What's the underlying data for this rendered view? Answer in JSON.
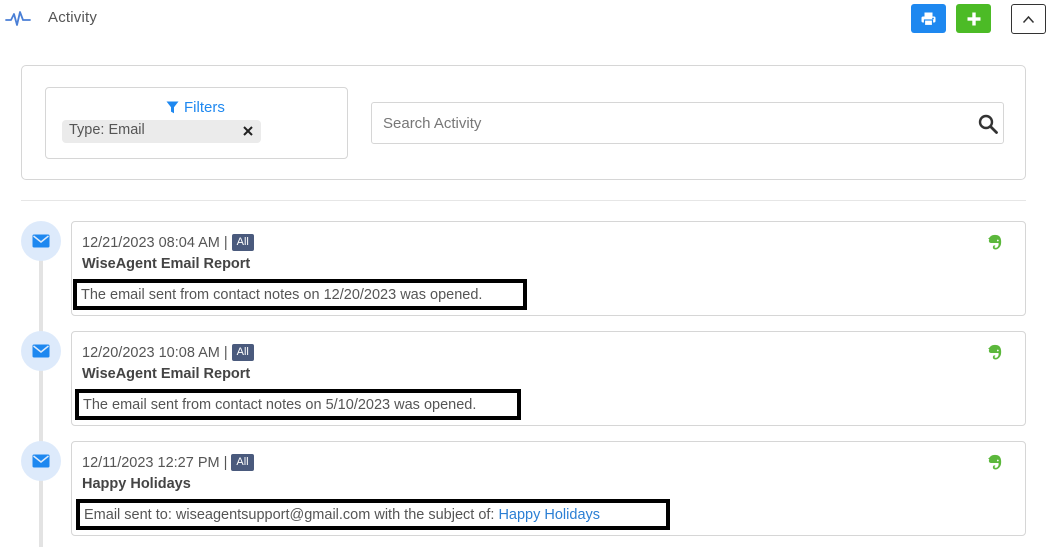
{
  "header": {
    "title": "Activity",
    "activity_icon": "pulse-icon",
    "print_icon": "printer-icon",
    "add_icon": "plus-icon",
    "collapse_icon": "chevron-up-icon"
  },
  "filters": {
    "label": "Filters",
    "icon": "funnel-icon",
    "chip_label": "Type: Email",
    "chip_close_icon": "close-icon"
  },
  "search": {
    "placeholder": "Search Activity",
    "icon": "search-icon"
  },
  "entries": [
    {
      "datetime": "12/21/2023 08:04 AM",
      "separator": "|",
      "badge": "All",
      "title": "WiseAgent Email Report",
      "body": "The email sent from contact notes on 12/20/2023 was opened.",
      "icon": "envelope-icon",
      "action_icon": "evernote-icon"
    },
    {
      "datetime": "12/20/2023 10:08 AM",
      "separator": "|",
      "badge": "All",
      "title": "WiseAgent Email Report",
      "body": "The email sent from contact notes on 5/10/2023 was opened.",
      "icon": "envelope-icon",
      "action_icon": "evernote-icon"
    },
    {
      "datetime": "12/11/2023 12:27 PM",
      "separator": "|",
      "badge": "All",
      "title": "Happy Holidays",
      "body": "Email sent to: wiseagentsupport@gmail.com with the subject of:",
      "body_link": "Happy Holidays",
      "icon": "envelope-icon",
      "action_icon": "evernote-icon"
    }
  ],
  "colors": {
    "primary_blue": "#1e88f0",
    "success_green": "#4cbb26",
    "badge_bg": "#4a5a7d",
    "timeline_circle": "#ddeafb",
    "evernote_green": "#5cb83c",
    "link_blue": "#2b7fd4"
  }
}
